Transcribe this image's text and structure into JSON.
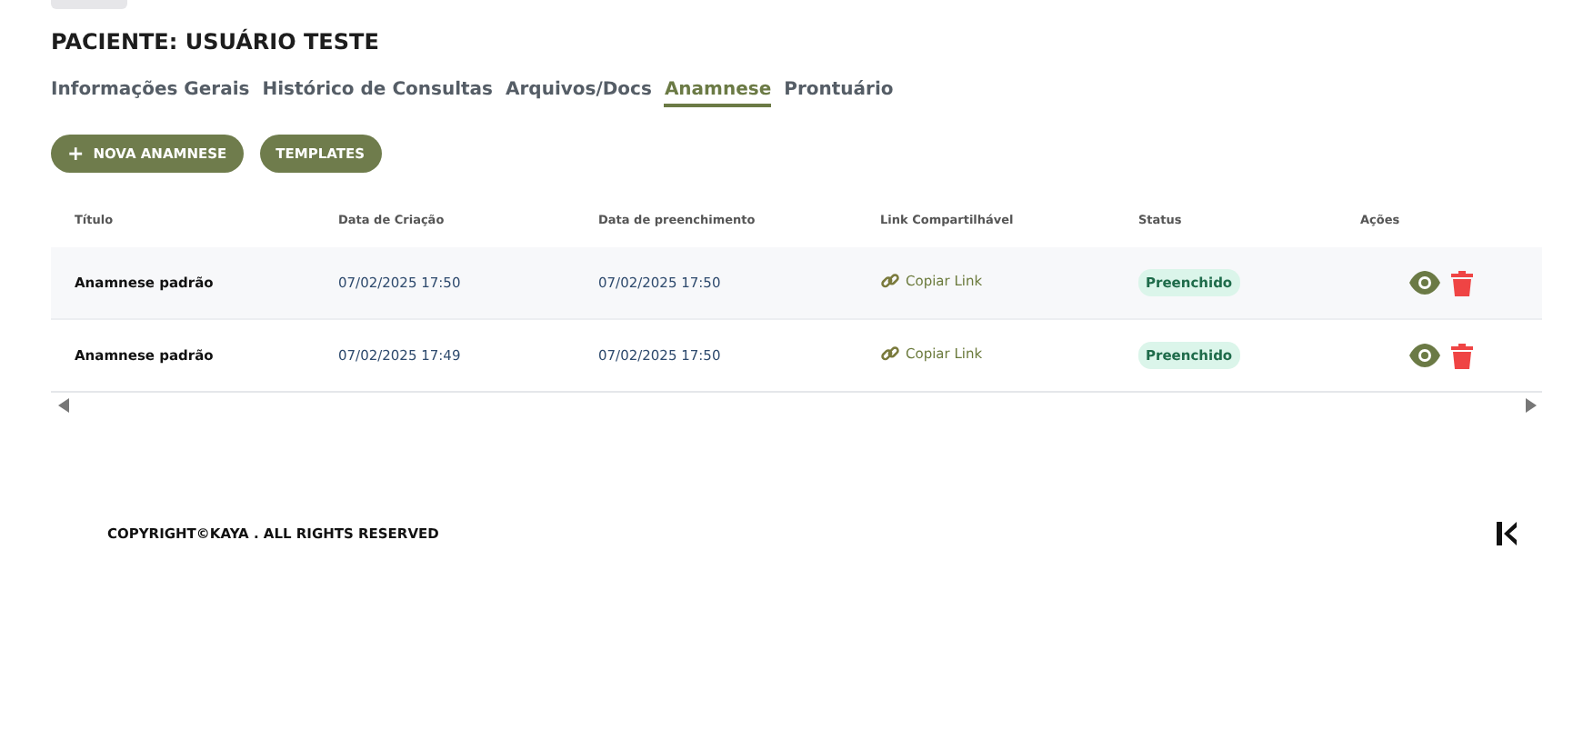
{
  "title": "PACIENTE: USUÁRIO TESTE",
  "tabs": [
    {
      "label": "Informações Gerais",
      "selected": false
    },
    {
      "label": "Histórico de Consultas",
      "selected": false
    },
    {
      "label": "Arquivos/Docs",
      "selected": false
    },
    {
      "label": "Anamnese",
      "selected": true
    },
    {
      "label": "Prontuário",
      "selected": false
    }
  ],
  "buttons": [
    {
      "label": "+",
      "kind": "icon-text",
      "text": "NOVA ANAMNESE"
    },
    {
      "kind": "text",
      "text": "TEMPLATES"
    }
  ],
  "table": {
    "columns": [
      "Título",
      "Data de Criação",
      "Data de preenchimento",
      "Link Compartilhável",
      "Status",
      "Ações"
    ],
    "rows": [
      {
        "title": "Anamnese padrão",
        "created": "07/02/2025 17:50",
        "filled": "07/02/2025 17:50",
        "link": "Copiar Link",
        "status": "Preenchido"
      },
      {
        "title": "Anamnese padrão",
        "created": "07/02/2025 17:49",
        "filled": "07/02/2025 17:50",
        "link": "Copiar Link",
        "status": "Preenchido"
      }
    ]
  },
  "footer": {
    "copyright": "COPYRIGHT©KAYA . ALL RIGHTS RESERVED"
  }
}
